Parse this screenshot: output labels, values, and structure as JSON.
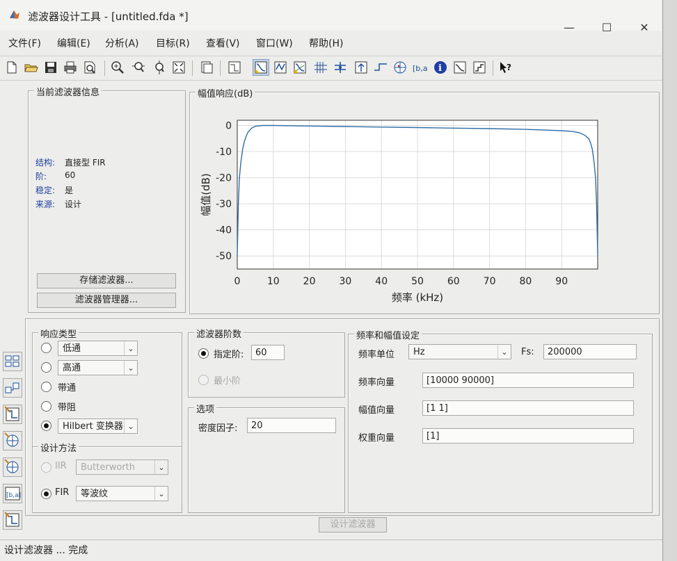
{
  "window": {
    "title": "滤波器设计工具 - [untitled.fda *]",
    "minimize": "—",
    "maximize": "☐",
    "close": "✕"
  },
  "menu": [
    "文件(F)",
    "编辑(E)",
    "分析(A)",
    "目标(R)",
    "查看(V)",
    "窗口(W)",
    "帮助(H)"
  ],
  "toolbar": {
    "icons": [
      "new-file-icon",
      "open-folder-icon",
      "save-icon",
      "print-icon",
      "print-preview-icon",
      "zoom-in-icon",
      "zoom-x-icon",
      "zoom-y-icon",
      "full-view-icon",
      "filter-specs-icon",
      "magnitude-response-icon",
      "magnitude-response-active-icon",
      "phase-response-icon",
      "magnitude-phase-icon",
      "group-delay-icon",
      "phase-delay-icon",
      "impulse-response-icon",
      "step-response-icon",
      "pole-zero-icon",
      "coefficients-icon",
      "info-icon",
      "magnitude-estimate-icon",
      "noise-power-icon",
      "whats-this-icon"
    ]
  },
  "current_filter": {
    "legend": "当前滤波器信息",
    "rows": [
      {
        "key": "结构:",
        "value": "直接型 FIR"
      },
      {
        "key": "阶:",
        "value": "60"
      },
      {
        "key": "稳定:",
        "value": "是"
      },
      {
        "key": "来源:",
        "value": "设计"
      }
    ],
    "store_button": "存储滤波器...",
    "manager_button": "滤波器管理器..."
  },
  "chart_data": {
    "type": "line",
    "title": "幅值响应(dB)",
    "xlabel": "频率 (kHz)",
    "ylabel": "幅值(dB)",
    "xlim": [
      0,
      100
    ],
    "ylim": [
      -55,
      2
    ],
    "xticks": [
      0,
      10,
      20,
      30,
      40,
      50,
      60,
      70,
      80,
      90
    ],
    "yticks": [
      0,
      -10,
      -20,
      -30,
      -40,
      -50
    ],
    "grid": true,
    "color": "#2f6fa8",
    "series": [
      {
        "x": [
          0,
          0.3,
          0.6,
          1,
          1.5,
          2,
          2.5,
          3,
          4,
          5,
          7,
          10,
          20,
          30,
          40,
          50,
          60,
          70,
          80,
          90,
          93,
          95,
          96.5,
          97.5,
          98,
          98.5,
          99,
          99.4,
          99.7,
          100
        ],
        "y": [
          -50,
          -30,
          -20,
          -14,
          -9,
          -6,
          -4,
          -2.5,
          -1,
          -0.3,
          0,
          0,
          -0.2,
          -0.4,
          -0.6,
          -0.8,
          -1,
          -1.2,
          -1.5,
          -2,
          -2.3,
          -2.8,
          -3.8,
          -5,
          -6.5,
          -9,
          -14,
          -20,
          -30,
          -50
        ]
      }
    ]
  },
  "response_type": {
    "legend": "响应类型",
    "options": [
      {
        "label": "低通",
        "dropdown": "",
        "checked": false
      },
      {
        "label": "高通",
        "dropdown": "",
        "checked": false
      },
      {
        "label": "带通",
        "checked": false
      },
      {
        "label": "带阻",
        "checked": false
      },
      {
        "label": "",
        "dropdown": "Hilbert 变换器",
        "checked": true
      }
    ]
  },
  "design_method": {
    "legend": "设计方法",
    "iir_label": "IIR",
    "iir_value": "Butterworth",
    "fir_label": "FIR",
    "fir_value": "等波纹"
  },
  "filter_order": {
    "legend": "滤波器阶数",
    "specify_label": "指定阶:",
    "specify_value": "60",
    "minimum_label": "最小阶"
  },
  "options": {
    "legend": "选项",
    "density_label": "密度因子:",
    "density_value": "20"
  },
  "freq_mag": {
    "legend": "频率和幅值设定",
    "unit_label": "频率单位",
    "unit_value": "Hz",
    "fs_label": "Fs:",
    "fs_value": "200000",
    "freq_vector_label": "频率向量",
    "freq_vector_value": "[10000 90000]",
    "mag_vector_label": "幅值向量",
    "mag_vector_value": "[1 1]",
    "weight_vector_label": "权重向量",
    "weight_vector_value": "[1]"
  },
  "design_button": "设计滤波器",
  "status": "设计滤波器 ... 完成"
}
